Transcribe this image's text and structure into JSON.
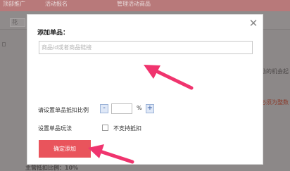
{
  "background": {
    "tabs": [
      "顶部推广",
      "活动报名",
      "管理活动商品"
    ],
    "sub_button": "花",
    "right_text_1": "励的机会起",
    "right_text_2": "必须为整数",
    "bottom_text": "主营抵扣比例：10%"
  },
  "modal": {
    "title": "添加单品：",
    "close_glyph": "✕",
    "product_input": {
      "placeholder": "商品id或者商品链接",
      "value": ""
    },
    "ratio_label": "请设置单品抵扣比例",
    "ratio_minus": "-",
    "ratio_value": "",
    "ratio_unit": "%",
    "ratio_plus": "+",
    "play_label": "设置单品玩法",
    "no_deduct_label": "不支持抵扣",
    "confirm_label": "确定添加"
  },
  "colors": {
    "primary_button": "#e9545c",
    "arrow": "#f0346e",
    "stepper": "#dfe8f7"
  }
}
